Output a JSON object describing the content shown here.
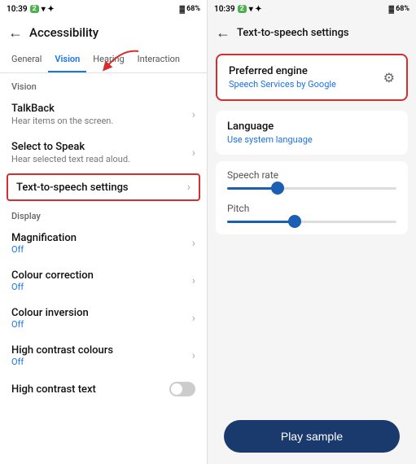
{
  "left": {
    "status": {
      "time": "10:39",
      "badge": "2",
      "battery": "68%"
    },
    "topbar": {
      "back_label": "←",
      "title": "Accessibility"
    },
    "tabs": [
      {
        "label": "General",
        "active": false
      },
      {
        "label": "Vision",
        "active": true
      },
      {
        "label": "Hearing",
        "active": false
      },
      {
        "label": "Interaction",
        "active": false
      }
    ],
    "vision_section": "Vision",
    "items": [
      {
        "title": "TalkBack",
        "sub": "Hear items on the screen.",
        "type": "chevron"
      },
      {
        "title": "Select to Speak",
        "sub": "Hear selected text read aloud.",
        "type": "chevron"
      },
      {
        "title": "Text-to-speech settings",
        "sub": "",
        "type": "chevron",
        "highlighted": true
      }
    ],
    "display_section": "Display",
    "display_items": [
      {
        "title": "Magnification",
        "status": "Off",
        "type": "chevron"
      },
      {
        "title": "Colour correction",
        "status": "Off",
        "type": "chevron"
      },
      {
        "title": "Colour inversion",
        "status": "Off",
        "type": "chevron"
      },
      {
        "title": "High contrast colours",
        "status": "Off",
        "type": "chevron"
      },
      {
        "title": "High contrast text",
        "status": "",
        "type": "toggle"
      }
    ]
  },
  "right": {
    "status": {
      "time": "10:39",
      "badge": "2",
      "battery": "68%"
    },
    "topbar": {
      "back_label": "←",
      "title": "Text-to-speech settings"
    },
    "preferred_engine": {
      "label": "Preferred engine",
      "sub": "Speech Services by Google"
    },
    "language": {
      "label": "Language",
      "sub": "Use system language"
    },
    "speech_rate": {
      "label": "Speech rate",
      "fill_pct": 30
    },
    "pitch": {
      "label": "Pitch",
      "fill_pct": 40
    },
    "play_button": "Play sample"
  }
}
